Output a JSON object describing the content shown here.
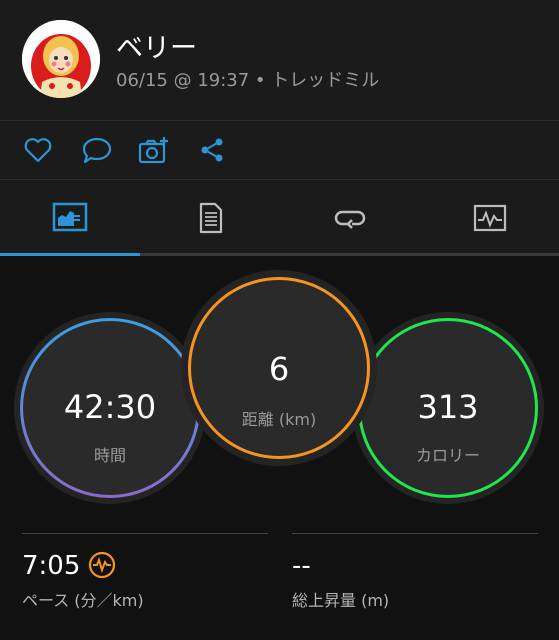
{
  "activity": {
    "user_name": "ベリー",
    "meta": "06/15 @ 19:37 • トレッドミル"
  },
  "actions": [
    "heart-icon",
    "comment-icon",
    "camera-add-icon",
    "share-icon"
  ],
  "tabs": [
    {
      "icon": "chart-icon",
      "active": true
    },
    {
      "icon": "document-icon",
      "active": false
    },
    {
      "icon": "repeat-icon",
      "active": false
    },
    {
      "icon": "activity-graph-icon",
      "active": false
    }
  ],
  "metrics": {
    "time": {
      "value": "42:30",
      "label": "時間"
    },
    "distance": {
      "value": "6",
      "label": "距離 (km)"
    },
    "calories": {
      "value": "313",
      "label": "カロリー"
    }
  },
  "stats": {
    "pace": {
      "value": "7:05",
      "label": "ペース (分／km)"
    },
    "ascent": {
      "value": "--",
      "label": "総上昇量 (m)"
    }
  },
  "colors": {
    "accent": "#2d95d4",
    "time_ring_top": "#3aa0e0",
    "time_ring_bottom": "#8a6cc8",
    "distance_ring": "#f7941d",
    "calories_ring": "#1ee84a",
    "pace_icon": "#f7941d"
  }
}
